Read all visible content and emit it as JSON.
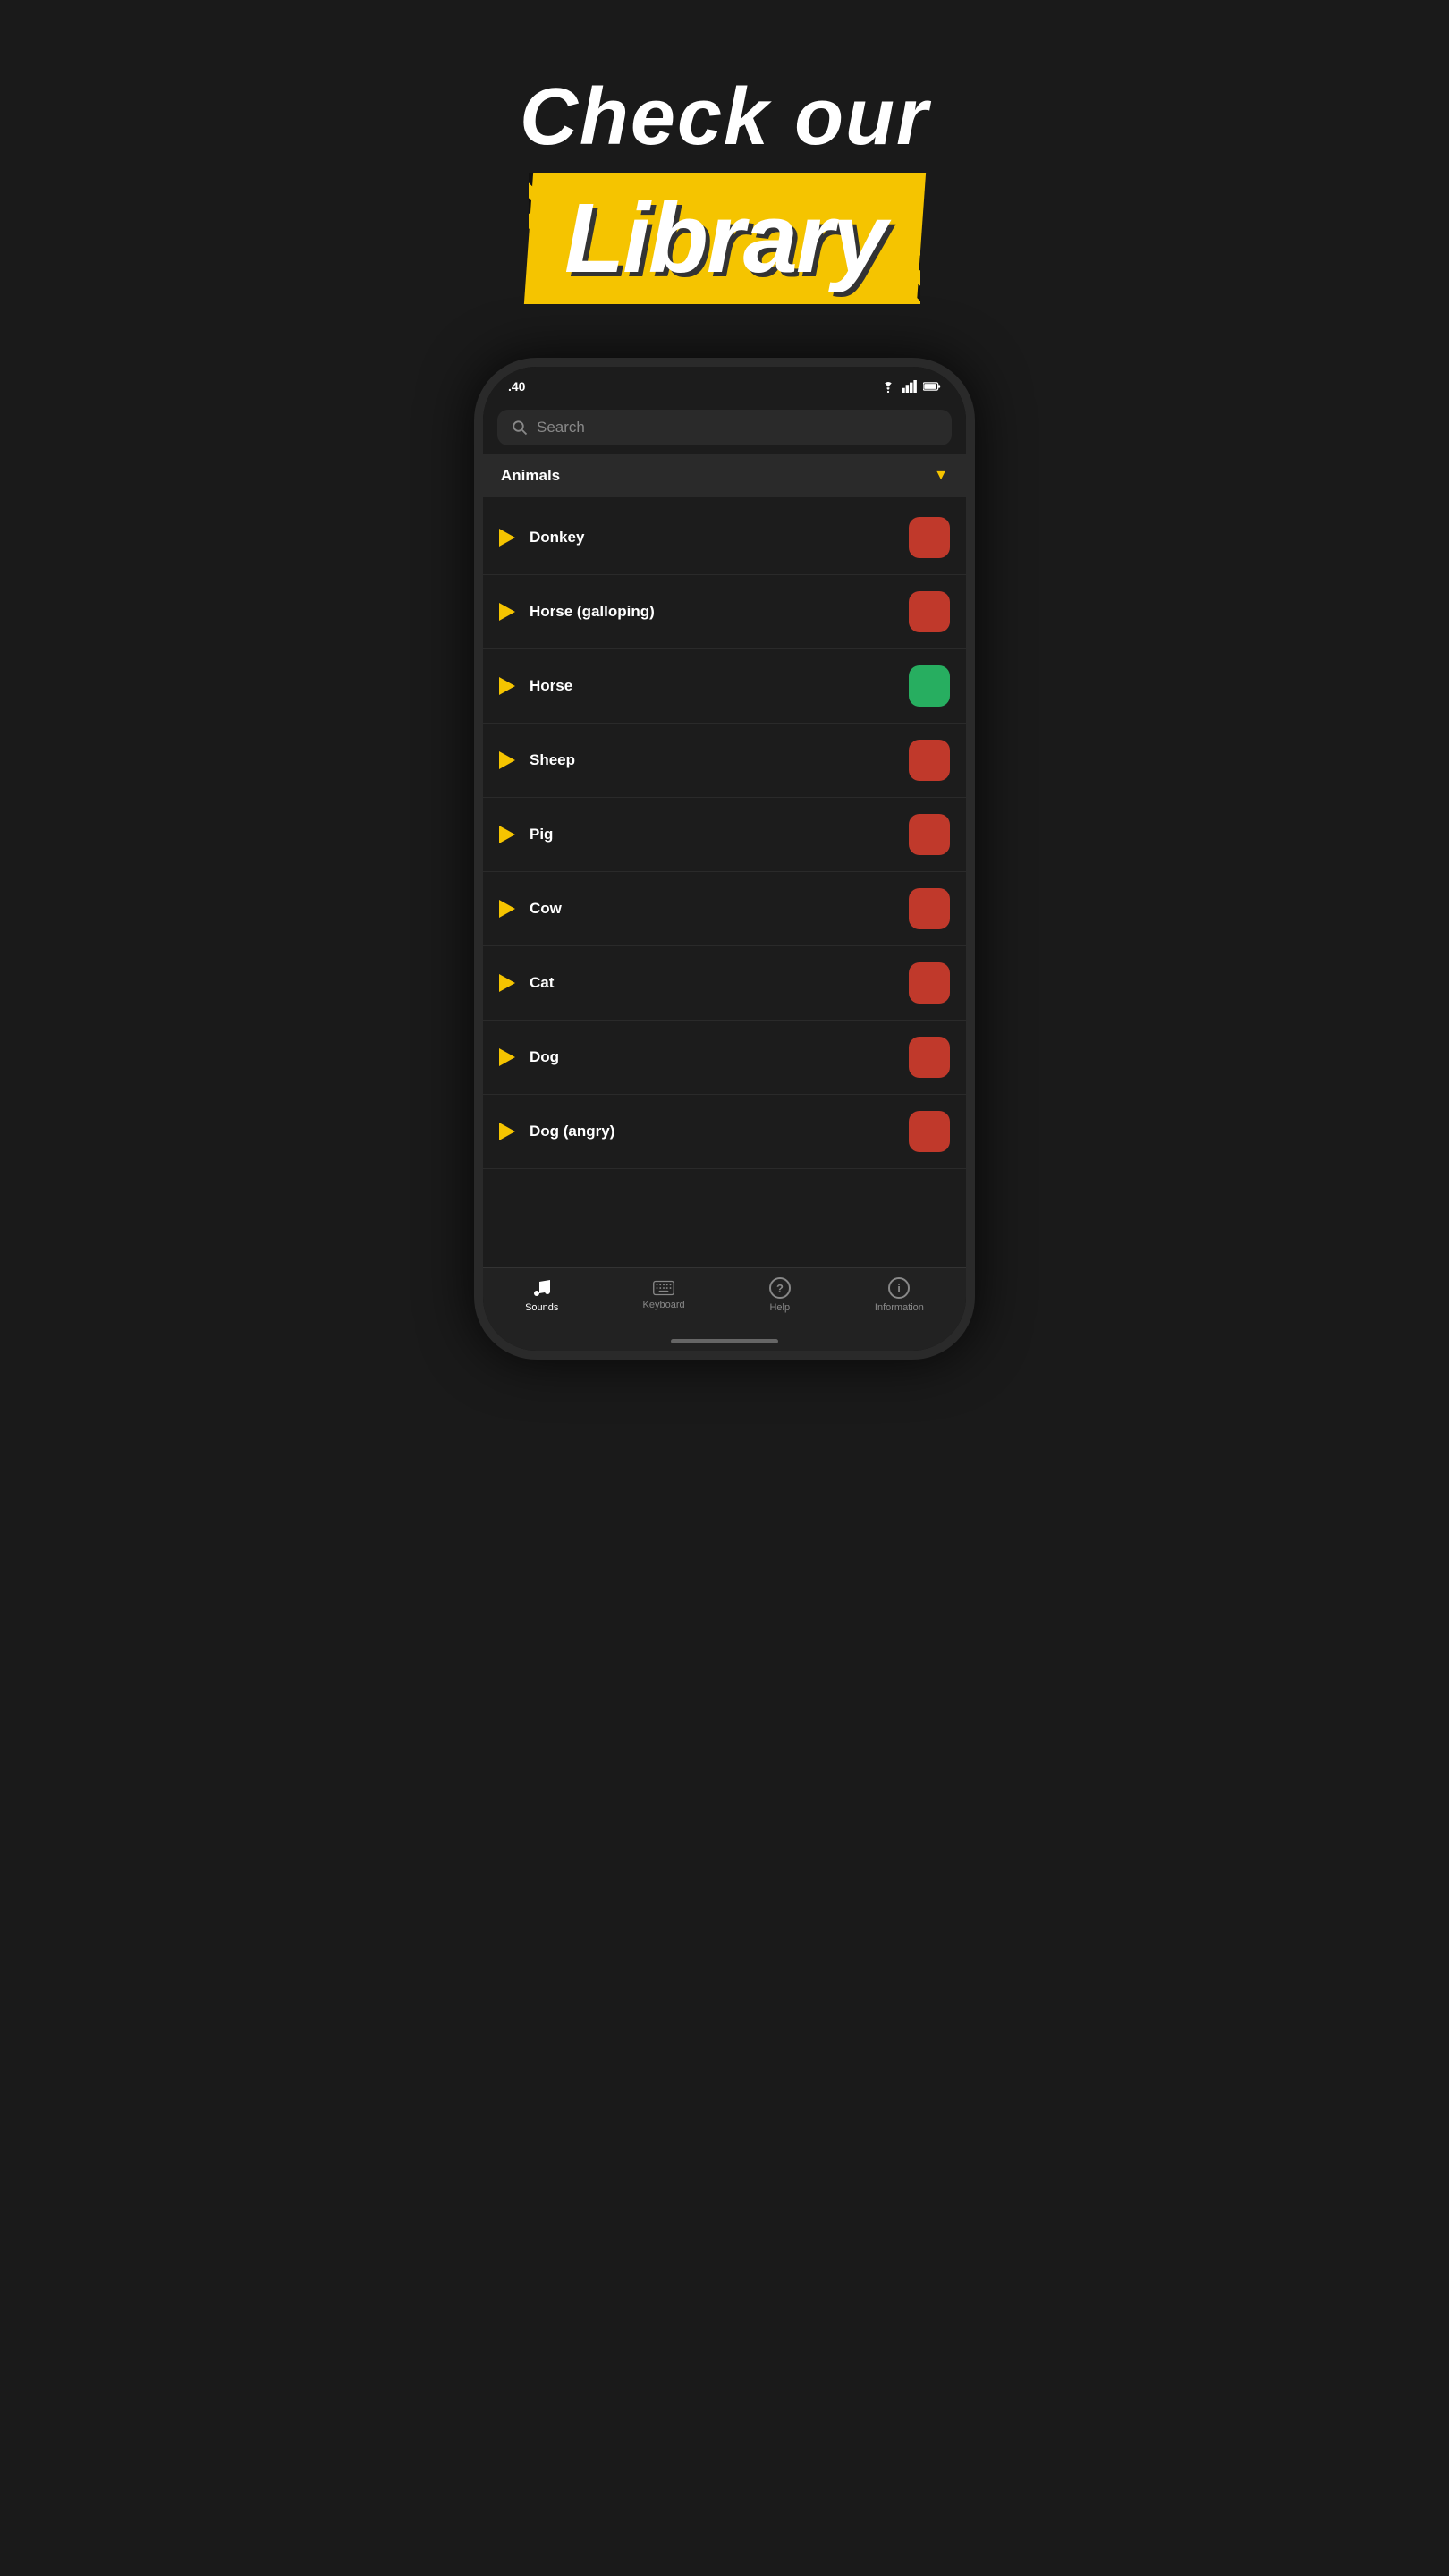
{
  "header": {
    "check_our": "Check our",
    "library": "Library"
  },
  "status_bar": {
    "time": ".40",
    "battery_icon": "battery",
    "wifi_icon": "wifi",
    "signal_icon": "signal"
  },
  "search": {
    "placeholder": "Search"
  },
  "category": {
    "label": "Animals",
    "chevron": "▼"
  },
  "sounds": [
    {
      "name": "Donkey",
      "active": false
    },
    {
      "name": "Horse (galloping)",
      "active": false
    },
    {
      "name": "Horse",
      "active": true
    },
    {
      "name": "Sheep",
      "active": false
    },
    {
      "name": "Pig",
      "active": false
    },
    {
      "name": "Cow",
      "active": false
    },
    {
      "name": "Cat",
      "active": false
    },
    {
      "name": "Dog",
      "active": false
    },
    {
      "name": "Dog (angry)",
      "active": false
    }
  ],
  "bottom_nav": {
    "items": [
      {
        "label": "Sounds",
        "icon": "♪",
        "active": true
      },
      {
        "label": "Keyboard",
        "icon": "⌨",
        "active": false
      },
      {
        "label": "Help",
        "icon": "?",
        "active": false
      },
      {
        "label": "Information",
        "icon": "ℹ",
        "active": false
      }
    ]
  }
}
